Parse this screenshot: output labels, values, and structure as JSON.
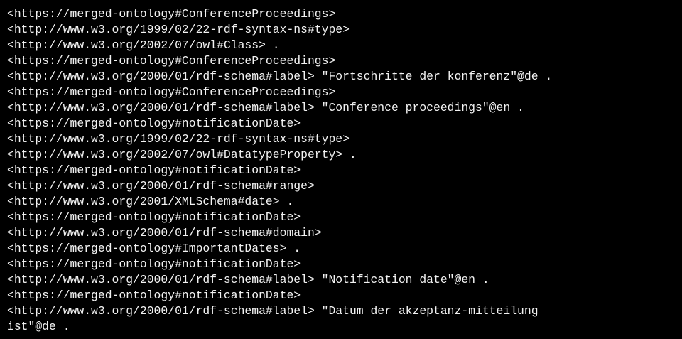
{
  "terminal": {
    "lines": [
      "<https://merged-ontology#ConferenceProceedings>",
      "<http://www.w3.org/1999/02/22-rdf-syntax-ns#type>",
      "<http://www.w3.org/2002/07/owl#Class> .",
      "<https://merged-ontology#ConferenceProceedings>",
      "<http://www.w3.org/2000/01/rdf-schema#label> \"Fortschritte der konferenz\"@de .",
      "<https://merged-ontology#ConferenceProceedings>",
      "<http://www.w3.org/2000/01/rdf-schema#label> \"Conference proceedings\"@en .",
      "<https://merged-ontology#notificationDate>",
      "<http://www.w3.org/1999/02/22-rdf-syntax-ns#type>",
      "<http://www.w3.org/2002/07/owl#DatatypeProperty> .",
      "<https://merged-ontology#notificationDate>",
      "<http://www.w3.org/2000/01/rdf-schema#range>",
      "<http://www.w3.org/2001/XMLSchema#date> .",
      "<https://merged-ontology#notificationDate>",
      "<http://www.w3.org/2000/01/rdf-schema#domain>",
      "<https://merged-ontology#ImportantDates> .",
      "<https://merged-ontology#notificationDate>",
      "<http://www.w3.org/2000/01/rdf-schema#label> \"Notification date\"@en .",
      "<https://merged-ontology#notificationDate>",
      "<http://www.w3.org/2000/01/rdf-schema#label> \"Datum der akzeptanz-mitteilung",
      "ist\"@de ."
    ]
  },
  "colors": {
    "background": "#000000",
    "text": "#f2f2f2"
  }
}
